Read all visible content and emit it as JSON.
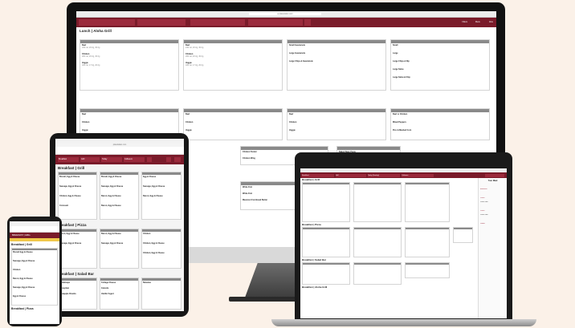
{
  "monitor": {
    "url": "qr.plateitalian.com",
    "toolbar": {
      "filters_label": "Filters",
      "menu_label": "Menu",
      "more_label": "More"
    },
    "section_title": "Lunch | Aloha Grill",
    "columns": [
      {
        "items": [
          [
            "Beef",
            "240 cal, 20.0g, 30.0g"
          ],
          [
            "Chicken",
            "200 cal, 20.0g, 30.0g"
          ],
          [
            "Veggie",
            "180 cal, 17.0g, 20.0g"
          ]
        ]
      },
      {
        "items": [
          [
            "Beef",
            "240 cal, 20.0g, 30.0g"
          ],
          [
            "Chicken",
            "200 cal, 20.0g, 30.0g"
          ],
          [
            "Veggie",
            "180 cal, 17.0g, 20.0g"
          ]
        ]
      },
      {
        "items": [
          [
            "Small Guacamole",
            ""
          ],
          [
            "Large Guacamole",
            ""
          ],
          [
            "Large Chips & Guacamole",
            ""
          ]
        ]
      },
      {
        "items": [
          [
            "Small",
            ""
          ],
          [
            "Large",
            ""
          ],
          [
            "Large Chips & Dip",
            ""
          ],
          [
            "Large Salsa",
            ""
          ],
          [
            "Large Salsa & Chip",
            ""
          ]
        ]
      }
    ],
    "row2": [
      {
        "items": [
          [
            "Beef",
            ""
          ],
          [
            "Chicken",
            ""
          ],
          [
            "Veggie",
            ""
          ]
        ]
      },
      {
        "items": [
          [
            "Beef",
            ""
          ],
          [
            "Chicken",
            ""
          ],
          [
            "Veggie",
            ""
          ]
        ]
      },
      {
        "items": [
          [
            "Beef",
            ""
          ],
          [
            "Chicken",
            ""
          ],
          [
            "Veggie",
            ""
          ]
        ]
      },
      {
        "items": [
          [
            "Beef or Chicken",
            ""
          ],
          [
            "Mixed Peppers",
            ""
          ],
          [
            "Pico & Mashed Corn",
            ""
          ]
        ]
      }
    ],
    "row3": [
      {
        "items": [
          [
            "Chicken Tender",
            ""
          ],
          [
            "Chicken Wing",
            ""
          ]
        ]
      },
      {
        "items": [
          [
            "Baked Bean Pasta",
            ""
          ],
          [
            "Penne Pasta",
            ""
          ]
        ]
      }
    ],
    "row4": [
      {
        "items": [
          [
            "White Fish",
            ""
          ],
          [
            "White Fish",
            ""
          ],
          [
            "Macaroni Cornbread Butter",
            ""
          ]
        ]
      }
    ]
  },
  "tablet": {
    "url": "plateitalian.com",
    "selectors": [
      "Breakfast",
      "Grill",
      "Today",
      "Collseum"
    ],
    "section1": "Breakfast | Grill",
    "grid1": [
      [
        [
          "Biscuit, Egg & Cheese",
          ""
        ],
        [
          "Sausage, Egg & Cheese",
          ""
        ],
        [
          "Chicken, Egg & Cheese",
          ""
        ],
        [
          "Croissant",
          ""
        ]
      ],
      [
        [
          "Biscuit, Egg & Cheese",
          ""
        ],
        [
          "Sausage, Egg & Cheese",
          ""
        ],
        [
          "Bacon, Egg & Cheese",
          ""
        ],
        [
          "Bacon, Egg & Cheese",
          ""
        ]
      ],
      [
        [
          "Egg & Cheese",
          ""
        ],
        [
          "Sausage, Egg & Cheese",
          ""
        ],
        [
          "Bacon, Egg & Cheese",
          ""
        ]
      ]
    ],
    "section2": "Breakfast | Pizza",
    "grid2": [
      [
        [
          "Bacon, Egg & Cheese",
          ""
        ],
        [
          "Sausage, Egg & Cheese",
          ""
        ]
      ],
      [
        [
          "Bacon, Egg & Cheese",
          ""
        ],
        [
          "Sausage, Egg & Cheese",
          ""
        ]
      ],
      [
        [
          "Chicken",
          ""
        ],
        [
          "Chicken, Egg & Cheese",
          ""
        ],
        [
          "Chicken, Egg & Cheese",
          ""
        ]
      ]
    ],
    "section3": "Breakfast | Salad Bar",
    "grid3": [
      [
        [
          "Cantaloupe",
          ""
        ],
        [
          "Honeydew",
          ""
        ],
        [
          "Pineapple Chunks",
          ""
        ]
      ],
      [
        [
          "Cottage Cheese",
          ""
        ],
        [
          "Granola",
          ""
        ],
        [
          "Vanilla Yogurt",
          ""
        ]
      ],
      [
        [
          "Bananas",
          ""
        ]
      ]
    ]
  },
  "laptop": {
    "selectors": [
      "Breakfast",
      "Grill",
      "Today (Sunday)",
      "Collseum"
    ],
    "side_title": "Your Meal",
    "sections": [
      "Breakfast | Grill",
      "Breakfast | Pizza",
      "Breakfast | Salad Bar",
      "Breakfast | Aloha Grill"
    ],
    "sidebar_items": [
      "Breakfast",
      "Lunch",
      "Lunch Grill",
      "Lunch",
      "Lunch Grill",
      "Dinner"
    ]
  },
  "phone": {
    "banner": "BREAKFAST | GRILL",
    "section1": "Breakfast | Grill",
    "items": [
      "Biscuit Egg & Cheese",
      "Sausage, Egg & Cheese",
      "Chicken",
      "Bacon, Egg & Cheese",
      "Sausage, Egg & Cheese",
      "Egg & Cheese"
    ],
    "section2": "Breakfast | Pizza"
  }
}
